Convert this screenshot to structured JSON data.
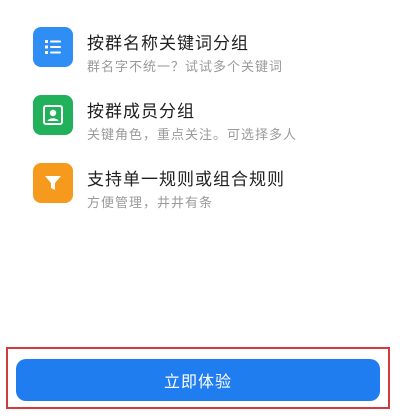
{
  "features": [
    {
      "title": "按群名称关键词分组",
      "desc": "群名字不统一？试试多个关键词",
      "icon": "list-icon",
      "color": "#2f8ef3"
    },
    {
      "title": "按群成员分组",
      "desc": "关键角色，重点关注。可选择多人",
      "icon": "user-icon",
      "color": "#20b15a"
    },
    {
      "title": "支持单一规则或组合规则",
      "desc": "方便管理，井井有条",
      "icon": "filter-icon",
      "color": "#f59a1c"
    }
  ],
  "cta": {
    "label": "立即体验",
    "color": "#1f7df0"
  }
}
